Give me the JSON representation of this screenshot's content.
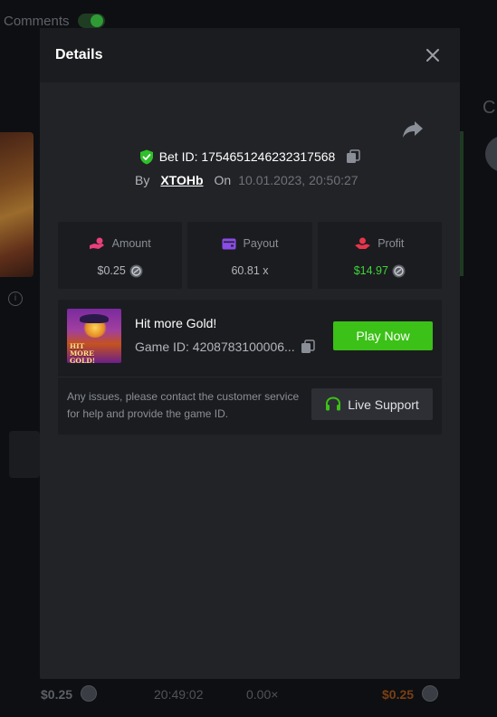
{
  "background": {
    "comments_label": "Comments",
    "right_partial_letter": "C",
    "footer": {
      "amount": "$0.25",
      "time": "20:49:02",
      "multiplier": "0.00×",
      "profit": "$0.25"
    }
  },
  "modal": {
    "title": "Details",
    "bet": {
      "id_label": "Bet ID: 1754651246232317568",
      "by_label": "By",
      "username": "XTOHb",
      "on_label": "On",
      "date": "10.01.2023, 20:50:27"
    },
    "stats": [
      {
        "label": "Amount",
        "value": "$0.25",
        "icon": "coins-hand-icon"
      },
      {
        "label": "Payout",
        "value": "60.81 x",
        "icon": "wallet-icon"
      },
      {
        "label": "Profit",
        "value": "$14.97",
        "icon": "hand-coin-icon"
      }
    ],
    "game": {
      "name": "Hit more Gold!",
      "id_label": "Game ID: 4208783100006...",
      "thumb_title": "HIT MORE GOLD!",
      "play_label": "Play Now"
    },
    "support": {
      "text": "Any issues, please contact the customer service for help and provide the game ID.",
      "button_label": "Live Support"
    }
  },
  "colors": {
    "accent_green": "#3bc117",
    "profit_green": "#3fd33a",
    "verified_green": "#2fc02a",
    "amount_icon": "#e8407b",
    "payout_icon": "#8a4be8",
    "profit_icon": "#e5364b"
  }
}
